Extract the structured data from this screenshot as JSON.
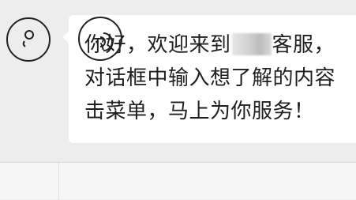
{
  "chat": {
    "message": {
      "line1_before": "你好，欢迎来到",
      "line1_after": "客服，",
      "line2": "对话框中输入想了解的内容",
      "line3": "击菜单，马上为你服务！"
    }
  },
  "input_bar": {
    "left_button_icon": "menu-toggle-icon",
    "voice_button_icon": "voice-icon"
  },
  "colors": {
    "chat_background": "#ededed",
    "bubble_background": "#ffffff",
    "text": "#1f1f1f",
    "toolbar_background": "#f7f7f7"
  }
}
